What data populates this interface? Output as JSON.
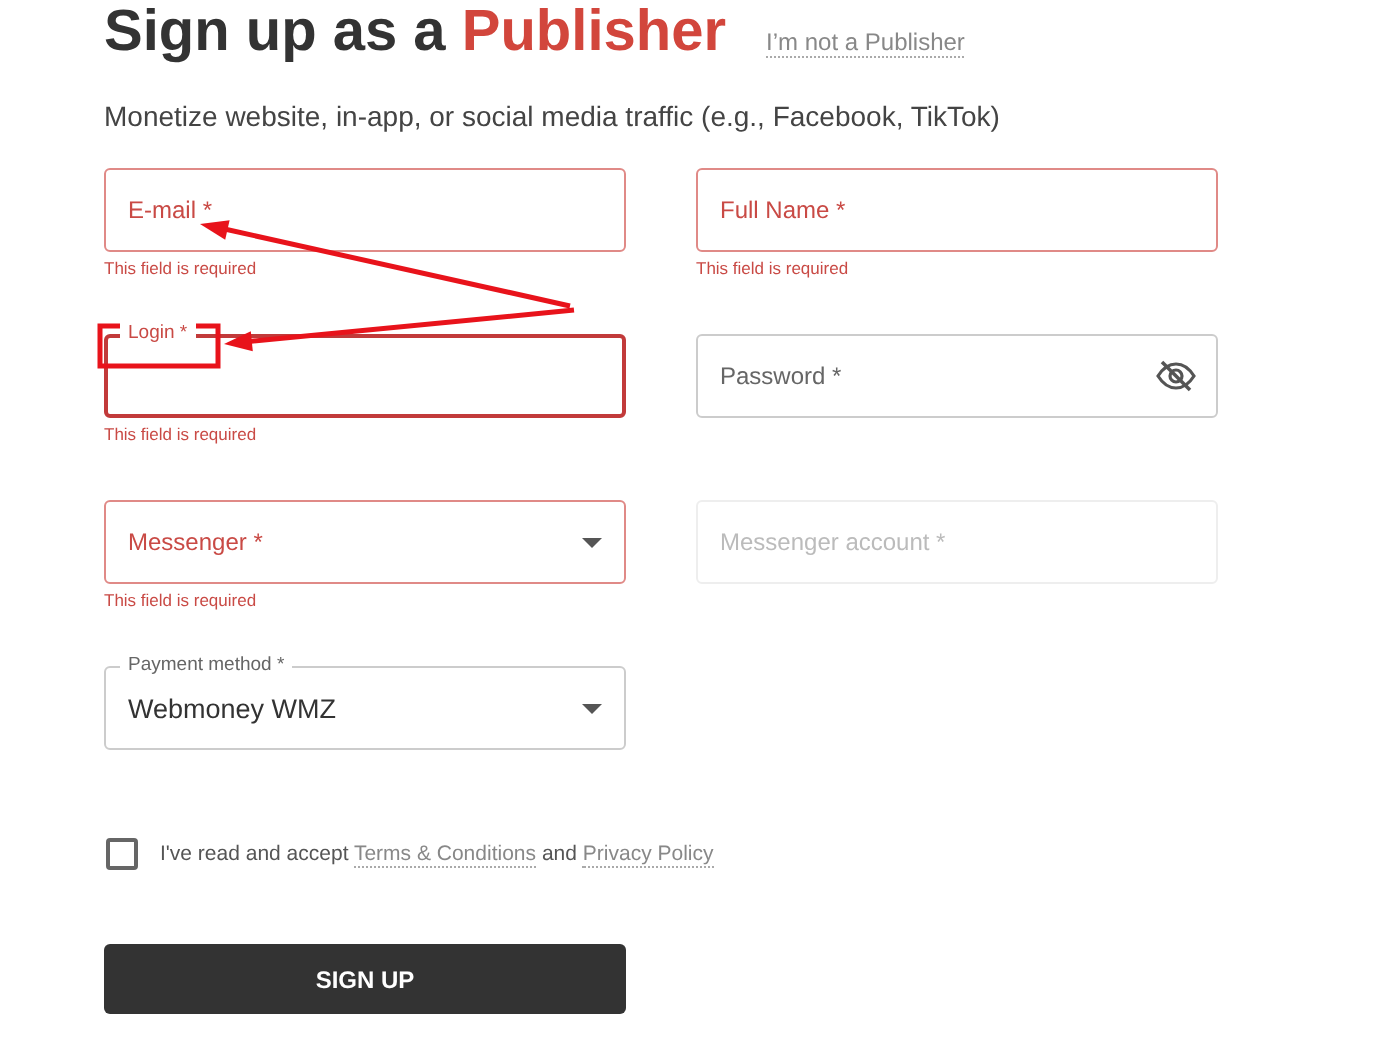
{
  "heading": {
    "text": "Sign up as a",
    "highlight": "Publisher"
  },
  "switch_link": "I’m not a Publisher",
  "subtitle": "Monetize website, in-app, or social media traffic (e.g., Facebook, TikTok)",
  "fields": [
    {
      "kind": "text",
      "label": "E-mail *",
      "invalid": true,
      "disabled": false,
      "focused": false,
      "error": "This field is required"
    },
    {
      "kind": "text",
      "label": "Full Name *",
      "invalid": true,
      "disabled": false,
      "focused": false,
      "error": "This field is required"
    },
    {
      "kind": "text",
      "label": "Login *",
      "invalid": true,
      "disabled": false,
      "focused": true,
      "error": "This field is required"
    },
    {
      "kind": "password",
      "label": "Password *",
      "invalid": false,
      "disabled": false,
      "focused": false
    },
    {
      "kind": "select",
      "label": "Messenger *",
      "invalid": true,
      "disabled": false,
      "focused": false,
      "error": "This field is required"
    },
    {
      "kind": "text",
      "label": "Messenger account *",
      "invalid": false,
      "disabled": true,
      "focused": false
    },
    {
      "kind": "select",
      "label": "Payment method *",
      "value": "Webmoney WMZ",
      "invalid": false,
      "disabled": false,
      "focused": false
    }
  ],
  "agreement": {
    "checked": false,
    "parts": [
      {
        "kind": "text",
        "text": "I've read and accept"
      },
      {
        "kind": "link",
        "text": "Terms & Conditions"
      },
      {
        "kind": "text",
        "text": "and"
      },
      {
        "kind": "link",
        "text": "Privacy Policy"
      }
    ]
  },
  "submit": "SIGN UP",
  "annotations": [
    {
      "kind": "arrow"
    },
    {
      "kind": "arrow"
    },
    {
      "kind": "frame"
    }
  ]
}
